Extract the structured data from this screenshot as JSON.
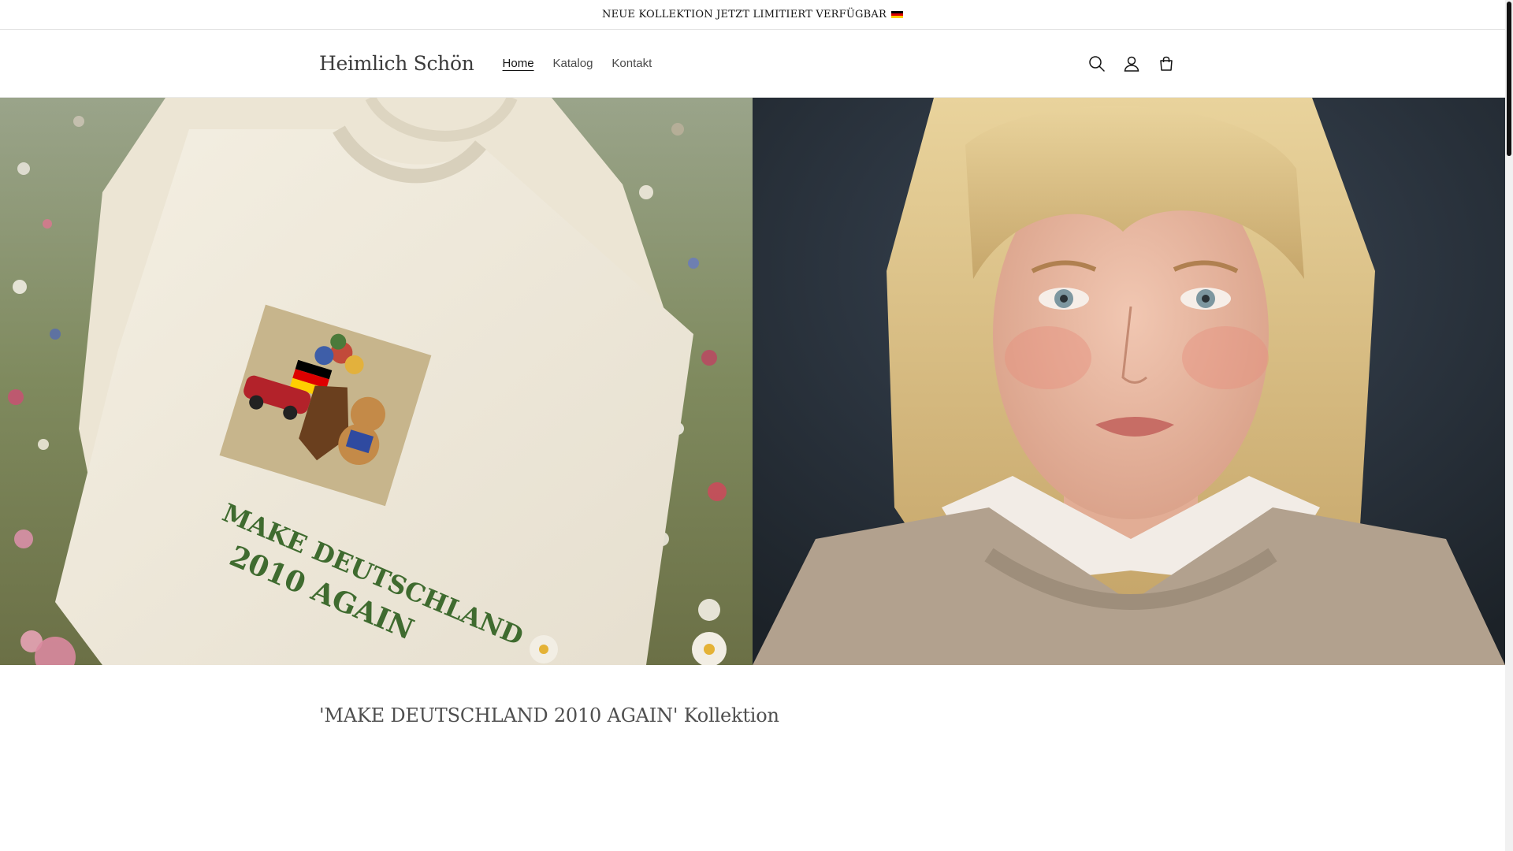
{
  "announcement": {
    "text": "NEUE KOLLEKTION JETZT LIMITIERT VERFÜGBAR",
    "flag_icon": "flag-germany-icon"
  },
  "header": {
    "logo": "Heimlich Schön",
    "nav": [
      {
        "label": "Home",
        "active": true
      },
      {
        "label": "Katalog",
        "active": false
      },
      {
        "label": "Kontakt",
        "active": false
      }
    ],
    "icons": [
      "search-icon",
      "account-icon",
      "cart-icon"
    ]
  },
  "hero": {
    "left_image": {
      "shirt_print_line1": "MAKE DEUTSCHLAND",
      "shirt_print_line2": "2010 AGAIN"
    }
  },
  "collection": {
    "title": "'MAKE DEUTSCHLAND 2010 AGAIN' Kollektion"
  },
  "colors": {
    "text": "#121212",
    "shirt_print_green": "#3f6b2f",
    "flag_black": "#000000",
    "flag_red": "#dd0000",
    "flag_gold": "#ffce00"
  }
}
